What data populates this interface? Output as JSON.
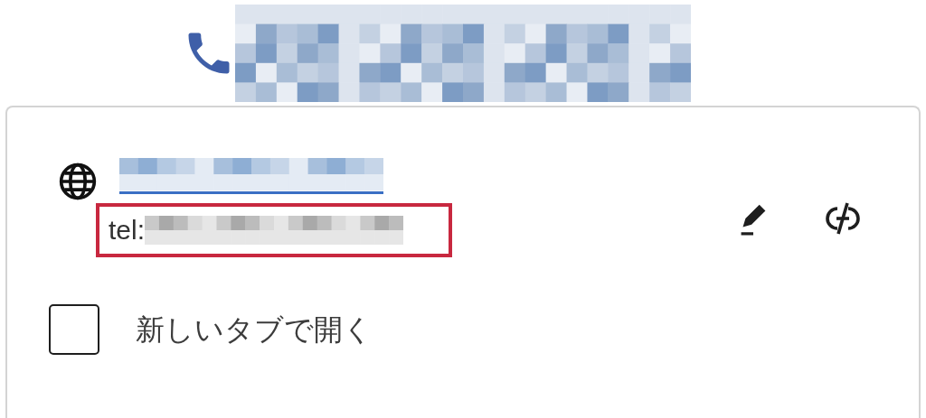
{
  "link_popover": {
    "url_text": "tel:",
    "options": [
      {
        "kind": "checkbox",
        "label": "新しいタブで開く",
        "checked": false
      }
    ]
  }
}
